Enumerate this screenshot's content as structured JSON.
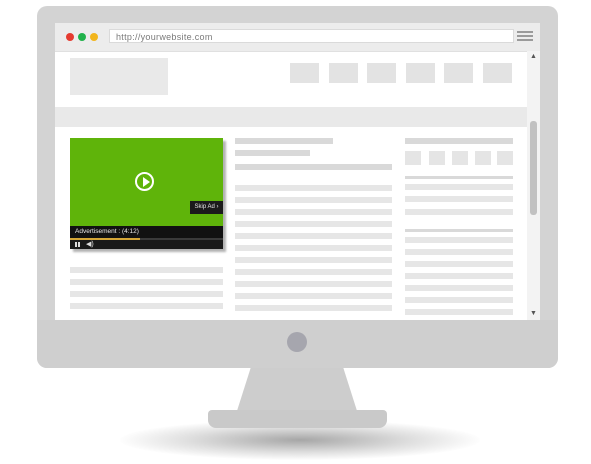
{
  "browser": {
    "url": "http://yourwebsite.com",
    "colors": {
      "red": "#e53b30",
      "green": "#21b24b",
      "yellow": "#f2b51c"
    }
  },
  "ad": {
    "skip_label": "Skip Ad ›",
    "info_label": "Advertisement : (4:12)",
    "progress": 0.46,
    "colors": {
      "video_bg": "#5fb40a",
      "progress": "#d4a637"
    }
  },
  "icons": [
    "menu-icon",
    "play-icon",
    "pause-icon",
    "volume-icon",
    "scroll-up-arrow-icon",
    "scroll-down-arrow-icon"
  ]
}
